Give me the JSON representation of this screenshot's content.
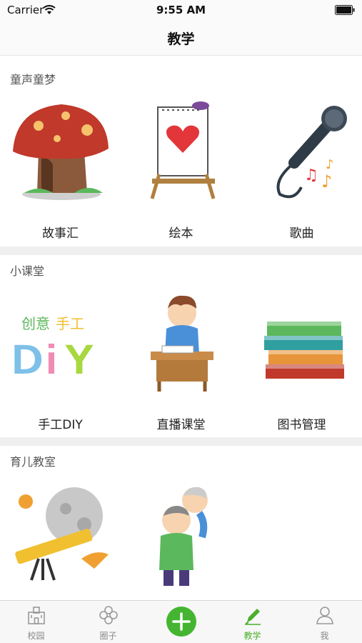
{
  "status": {
    "carrier": "Carrier",
    "time": "9:55 AM"
  },
  "nav": {
    "title": "教学"
  },
  "sections": [
    {
      "title": "童声童梦",
      "items": [
        {
          "label": "故事汇",
          "icon": "mushroom-house-icon"
        },
        {
          "label": "绘本",
          "icon": "easel-heart-icon"
        },
        {
          "label": "歌曲",
          "icon": "microphone-icon"
        }
      ]
    },
    {
      "title": "小课堂",
      "items": [
        {
          "label": "手工DIY",
          "icon": "diy-letters-icon"
        },
        {
          "label": "直播课堂",
          "icon": "student-desk-icon"
        },
        {
          "label": "图书管理",
          "icon": "book-stack-icon"
        }
      ]
    },
    {
      "title": "育儿教室",
      "items": [
        {
          "label": "",
          "icon": "telescope-moon-icon"
        },
        {
          "label": "",
          "icon": "grandparents-icon"
        }
      ]
    }
  ],
  "tabs": [
    {
      "label": "校园",
      "icon": "school-icon",
      "active": false
    },
    {
      "label": "圈子",
      "icon": "circle-flower-icon",
      "active": false
    },
    {
      "label": "",
      "icon": "add-icon",
      "active": false
    },
    {
      "label": "教学",
      "icon": "pencil-icon",
      "active": true
    },
    {
      "label": "我",
      "icon": "user-icon",
      "active": false
    }
  ],
  "colors": {
    "accent": "#45b531",
    "active_tab": "#4cae2c",
    "section_gap": "#efefef"
  }
}
